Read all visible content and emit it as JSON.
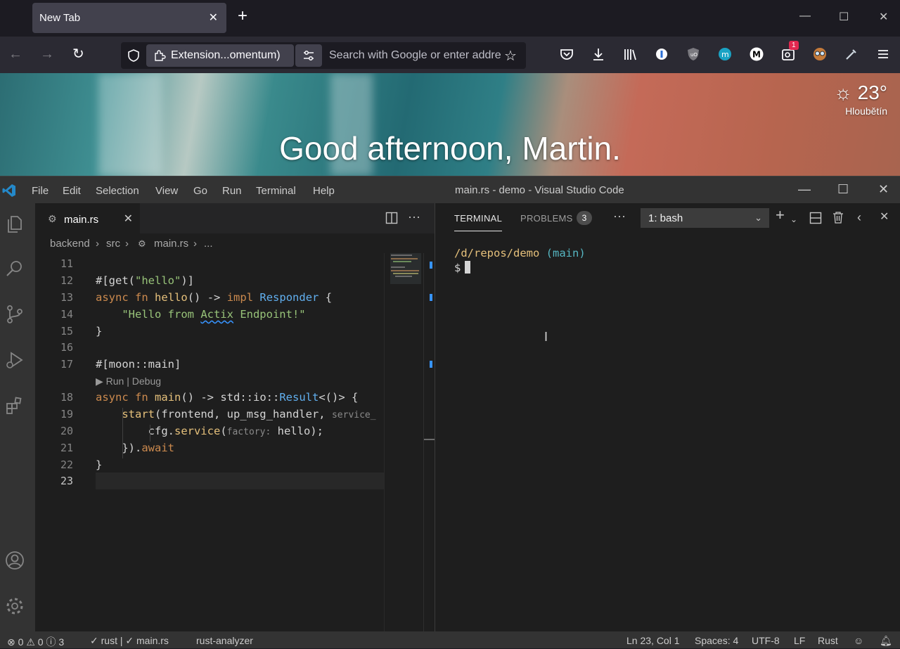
{
  "browser": {
    "tab_title": "New Tab",
    "tab_close": "✕",
    "new_tab": "+",
    "url_chip": "Extension...omentum)",
    "search_placeholder": "Search with Google or enter address",
    "window_controls": {
      "minimize": "—",
      "maximize": "☐",
      "close": "✕"
    },
    "toolbar_icons": [
      "pocket-icon",
      "download-icon",
      "library-icon",
      "onepassword-icon",
      "ublock-icon",
      "mastodon-icon",
      "medium-icon",
      "zoom-extension-icon",
      "owl-extension-icon",
      "colorpicker-icon",
      "menu-icon"
    ],
    "notification_badge": "1"
  },
  "newtab": {
    "greeting": "Good afternoon, Martin.",
    "weather": {
      "temp": "23°",
      "location": "Hloubětín",
      "icon": "sun-icon"
    }
  },
  "vscode": {
    "menu": [
      "File",
      "Edit",
      "Selection",
      "View",
      "Go",
      "Run",
      "Terminal",
      "Help"
    ],
    "window_title": "main.rs - demo - Visual Studio Code",
    "tab": {
      "label": "main.rs",
      "close": "✕"
    },
    "breadcrumb": {
      "part1": "backend",
      "part2": "src",
      "part3": "main.rs",
      "part4": "..."
    },
    "code_lens": "▶ Run | Debug",
    "line_numbers": [
      "11",
      "12",
      "13",
      "14",
      "15",
      "16",
      "17",
      "18",
      "19",
      "20",
      "21",
      "22",
      "23"
    ],
    "panel": {
      "terminal_tab": "TERMINAL",
      "problems_tab": "PROBLEMS",
      "problems_count": "3",
      "more": "···",
      "shell_selected": "1: bash",
      "path": "/d/repos/demo",
      "branch": "(main)",
      "prompt": "$"
    },
    "status": {
      "errors": "0",
      "warnings": "0",
      "infos": "3",
      "check_rust": "rust |",
      "check_main": "main.rs",
      "analyzer": "rust-analyzer",
      "position": "Ln 23, Col 1",
      "spaces": "Spaces: 4",
      "encoding": "UTF-8",
      "eol": "LF",
      "language": "Rust"
    },
    "colors": {
      "accent": "#007acc",
      "statusbar": "#333333",
      "editor_bg": "#1e1e1e"
    }
  }
}
